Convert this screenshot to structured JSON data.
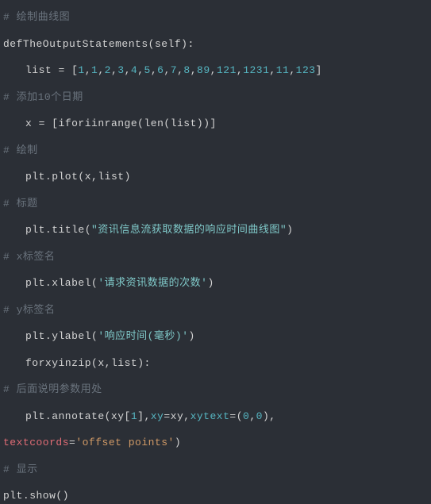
{
  "lines": {
    "comment1": "# 绘制曲线图",
    "def_kw": "def",
    "funcname": "TheOutputStatements",
    "self": "self",
    "list_eq": "list = [",
    "nums": [
      "1",
      "1",
      "2",
      "3",
      "4",
      "5",
      "6",
      "7",
      "8",
      "89",
      "121",
      "1231",
      "11",
      "123"
    ],
    "close_bracket": "]",
    "comment2": "# 添加10个日期",
    "x_eq": "x = [",
    "ifor": "i",
    "for1": "for",
    "i_in": "i",
    "in1": "in",
    "range": "range",
    "len": "len",
    "list_arg": "list",
    "close_paren2": "))]",
    "comment3": "# 绘制",
    "plot_call": "plt.plot(",
    "plot_x": "x",
    "plot_list": "list",
    "plot_close": ")",
    "comment4": "# 标题",
    "title_call": "plt.title(",
    "title_str": "\"资讯信息流获取数据的响应时间曲线图\"",
    "title_close": ")",
    "comment5": "# x标签名",
    "xlabel_call": "plt.xlabel(",
    "xlabel_str": "'请求资讯数据的次数'",
    "xlabel_close": ")",
    "comment6": "# y标签名",
    "ylabel_call": "plt.ylabel(",
    "ylabel_str": "'响应时间(毫秒)'",
    "ylabel_close": ")",
    "for2": "for",
    "xy": "xy",
    "in2": "in",
    "zip": "zip",
    "zip_args_open": "(",
    "zip_x": "x",
    "zip_list": "list",
    "zip_close": "):",
    "comment7": "# 后面说明参数用处",
    "annotate_call": "plt.annotate(",
    "xy_sub": "xy[",
    "idx1": "1",
    "xy_sub_close": "],",
    "kwarg_xy": "xy",
    "eq1": "=",
    "xy_val": "xy,",
    "kwarg_xytext": "xytext",
    "eq2": "=(",
    "zero1": "0",
    "zero2": "0",
    "annotate_close": "),",
    "kwarg_textcoords": "textcoords",
    "eq3": "=",
    "textcoords_str": "'offset points'",
    "tc_close": ")",
    "comment8": "# 显示",
    "show_call": "plt.show()"
  }
}
